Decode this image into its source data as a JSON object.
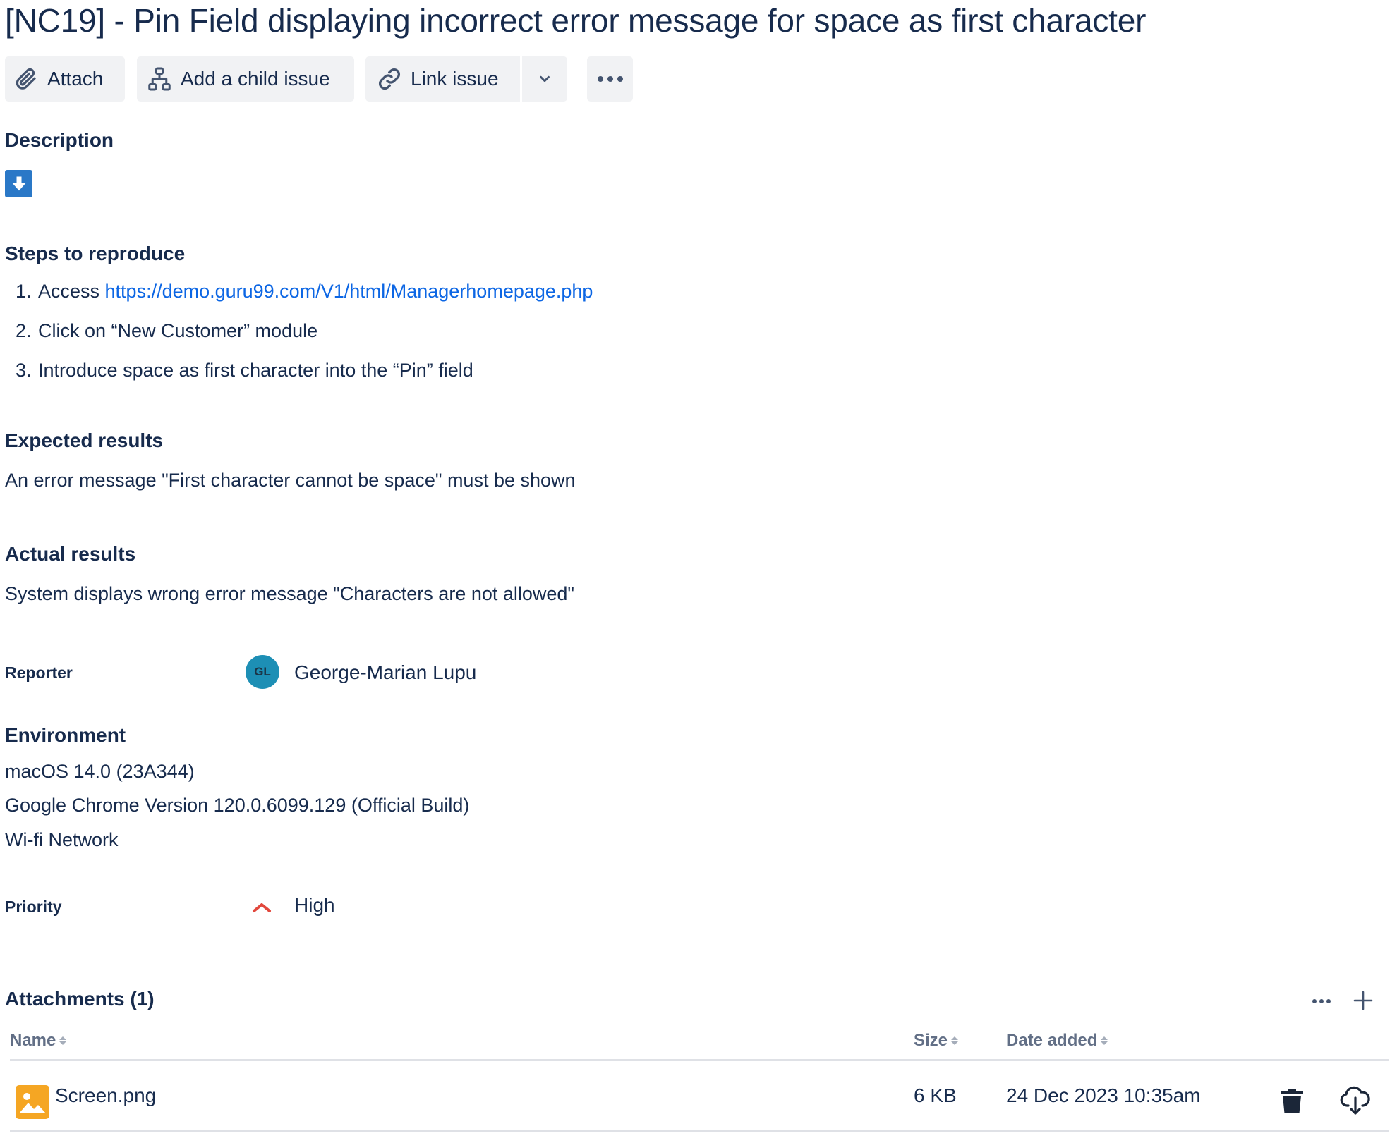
{
  "issue": {
    "title": "[NC19] - Pin Field displaying incorrect error message for space as first character"
  },
  "toolbar": {
    "attach_label": "Attach",
    "add_child_label": "Add a child issue",
    "link_issue_label": "Link issue"
  },
  "description": {
    "heading": "Description",
    "steps_heading": "Steps to reproduce",
    "steps": [
      {
        "num": "1.",
        "prefix": "Access ",
        "link": "https://demo.guru99.com/V1/html/Managerhomepage.php"
      },
      {
        "num": "2.",
        "text": "Click on “New Customer” module"
      },
      {
        "num": "3.",
        "text": "Introduce space as first character into the “Pin” field"
      }
    ],
    "expected_heading": "Expected results",
    "expected_text": "An error message \"First character cannot be space\" must be shown",
    "actual_heading": "Actual results",
    "actual_text": "System displays wrong error message \"Characters are not allowed\""
  },
  "reporter": {
    "label": "Reporter",
    "initials": "GL",
    "name": "George-Marian Lupu",
    "avatar_color": "#1d8fb5"
  },
  "environment": {
    "heading": "Environment",
    "lines": [
      "macOS 14.0 (23A344)",
      "Google Chrome Version 120.0.6099.129 (Official Build)",
      "Wi-fi Network"
    ]
  },
  "priority": {
    "label": "Priority",
    "value": "High",
    "icon": "priority-high-icon",
    "color": "#e2483d"
  },
  "attachments": {
    "heading": "Attachments (1)",
    "columns": [
      "Name",
      "Size",
      "Date added"
    ],
    "rows": [
      {
        "name": "Screen.png",
        "size": "6 KB",
        "date": "24 Dec 2023 10:35am"
      }
    ]
  },
  "colors": {
    "text": "#172b4d",
    "link": "#0c66e4",
    "button_bg": "#f1f2f4",
    "muted": "#626f86",
    "image_icon": "#f5a623"
  }
}
